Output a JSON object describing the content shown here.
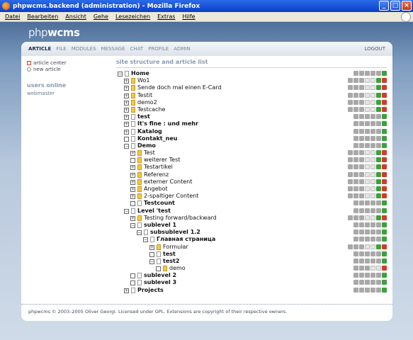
{
  "window": {
    "title": "phpwcms.backend (administration) - Mozilla Firefox"
  },
  "menu": [
    "Datei",
    "Bearbeiten",
    "Ansicht",
    "Gehe",
    "Lesezeichen",
    "Extras",
    "Hilfe"
  ],
  "logo": {
    "a": "php",
    "b": "wcms"
  },
  "nav": {
    "items": [
      "ARTICLE",
      "FILE",
      "MODULES",
      "MESSAGE",
      "CHAT",
      "PROFILE",
      "ADMIN"
    ],
    "logout": "LOGOUT"
  },
  "left": {
    "article_center": "article center",
    "new_article": "new article",
    "users_online": "users online",
    "webmaster": "webmaster"
  },
  "main": {
    "title": "site structure and article list"
  },
  "tree": [
    {
      "label": "Home",
      "level": 0,
      "box": "−",
      "bold": true,
      "folder": false,
      "acts": "gggggG"
    },
    {
      "label": "Wo1",
      "level": 1,
      "box": "+",
      "bold": false,
      "folder": true,
      "acts": "gggwwGR"
    },
    {
      "label": "Sende doch mal einen E-Card",
      "level": 1,
      "box": "+",
      "bold": false,
      "folder": true,
      "acts": "gggwwGR"
    },
    {
      "label": "Testit",
      "level": 1,
      "box": "+",
      "bold": false,
      "folder": true,
      "acts": "gggwwGR"
    },
    {
      "label": "demo2",
      "level": 1,
      "box": "+",
      "bold": false,
      "folder": true,
      "acts": "gggwwGR"
    },
    {
      "label": "Testcache",
      "level": 1,
      "box": "+",
      "bold": false,
      "folder": true,
      "acts": "gggwwGR"
    },
    {
      "label": "test",
      "level": 1,
      "box": "+",
      "bold": true,
      "folder": false,
      "acts": "gggggG"
    },
    {
      "label": "It's fine : und mehr",
      "level": 1,
      "box": "+",
      "bold": true,
      "folder": false,
      "acts": "gggggG"
    },
    {
      "label": "Katalog",
      "level": 1,
      "box": "+",
      "bold": true,
      "folder": false,
      "acts": "gggggG"
    },
    {
      "label": "Kontakt_neu",
      "level": 1,
      "box": "",
      "bold": true,
      "folder": false,
      "acts": "gggggG"
    },
    {
      "label": "Demo",
      "level": 1,
      "box": "−",
      "bold": true,
      "folder": false,
      "acts": "gggggG"
    },
    {
      "label": "Test",
      "level": 2,
      "box": "+",
      "bold": false,
      "folder": true,
      "acts": "gggwwGR"
    },
    {
      "label": "weiterer Test",
      "level": 2,
      "box": "",
      "bold": false,
      "folder": true,
      "acts": "gggwwGR"
    },
    {
      "label": "Testartikel",
      "level": 2,
      "box": "+",
      "bold": false,
      "folder": true,
      "acts": "gggwwGR"
    },
    {
      "label": "Referenz",
      "level": 2,
      "box": "+",
      "bold": false,
      "folder": true,
      "acts": "gggwwGR"
    },
    {
      "label": "externer Content",
      "level": 2,
      "box": "+",
      "bold": false,
      "folder": true,
      "acts": "gggwwGR"
    },
    {
      "label": "Angebot",
      "level": 2,
      "box": "+",
      "bold": false,
      "folder": true,
      "acts": "gggwwGR"
    },
    {
      "label": "2-spaltiger Content",
      "level": 2,
      "box": "+",
      "bold": false,
      "folder": true,
      "acts": "gggwwGR"
    },
    {
      "label": "Testcount",
      "level": 2,
      "box": "",
      "bold": true,
      "folder": false,
      "acts": "gggggG"
    },
    {
      "label": "Level 'test",
      "level": 1,
      "box": "−",
      "bold": true,
      "folder": false,
      "acts": "gggggG"
    },
    {
      "label": "Testing forward/backward",
      "level": 2,
      "box": "+",
      "bold": false,
      "folder": true,
      "acts": "gggwwGR"
    },
    {
      "label": "sublevel 1",
      "level": 2,
      "box": "−",
      "bold": true,
      "folder": false,
      "acts": "gggggG"
    },
    {
      "label": "subsublevel 1.2",
      "level": 3,
      "box": "−",
      "bold": true,
      "folder": false,
      "acts": "gggggG"
    },
    {
      "label": "Главная страница",
      "level": 4,
      "box": "−",
      "bold": true,
      "folder": false,
      "acts": "gggggG"
    },
    {
      "label": "Formular",
      "level": 5,
      "box": "+",
      "bold": false,
      "folder": true,
      "acts": "gggwwGR"
    },
    {
      "label": "test",
      "level": 5,
      "box": "",
      "bold": true,
      "folder": false,
      "acts": "gggggG"
    },
    {
      "label": "test2",
      "level": 5,
      "box": "−",
      "bold": true,
      "folder": false,
      "acts": "gggggG"
    },
    {
      "label": "demo",
      "level": 6,
      "box": "",
      "bold": false,
      "folder": true,
      "acts": "gggwwR"
    },
    {
      "label": "sublevel 2",
      "level": 2,
      "box": "",
      "bold": true,
      "folder": false,
      "acts": "gggggG"
    },
    {
      "label": "sublevel 3",
      "level": 2,
      "box": "",
      "bold": true,
      "folder": false,
      "acts": "gggggG"
    },
    {
      "label": "Projects",
      "level": 1,
      "box": "+",
      "bold": true,
      "folder": false,
      "acts": "gggggG"
    }
  ],
  "footer": "phpwcms © 2003–2005 Oliver Georgi. Licensed under GPL. Extensions are copyright of their respective owners."
}
